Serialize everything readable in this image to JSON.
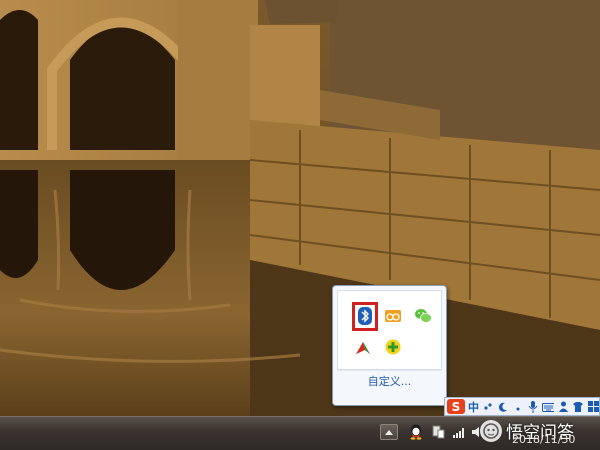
{
  "popup": {
    "customize_label": "自定义...",
    "icons": [
      {
        "name": "bluetooth-icon",
        "highlighted": true
      },
      {
        "name": "cloud-sync-icon"
      },
      {
        "name": "wechat-icon"
      },
      {
        "name": "red-arrow-app-icon"
      },
      {
        "name": "green-plus-app-icon"
      }
    ]
  },
  "ime": {
    "logo": "S",
    "mode": "中",
    "icons": [
      "punctuation-icon",
      "moon-icon",
      "dot-icon",
      "microphone-icon",
      "keyboard-icon",
      "user-icon",
      "skin-shirt-icon",
      "grid-toolbox-icon"
    ]
  },
  "taskbar": {
    "date": "2018/11/30",
    "tray_icons": [
      "show-hidden-icons-button",
      "qq-icon",
      "network-device-icon",
      "signal-bars-icon",
      "volume-icon"
    ]
  },
  "watermark": {
    "text": "悟空问答"
  },
  "colors": {
    "highlight_border": "#d0201f",
    "link": "#1e5aa8",
    "taskbar": "#3b3430"
  }
}
